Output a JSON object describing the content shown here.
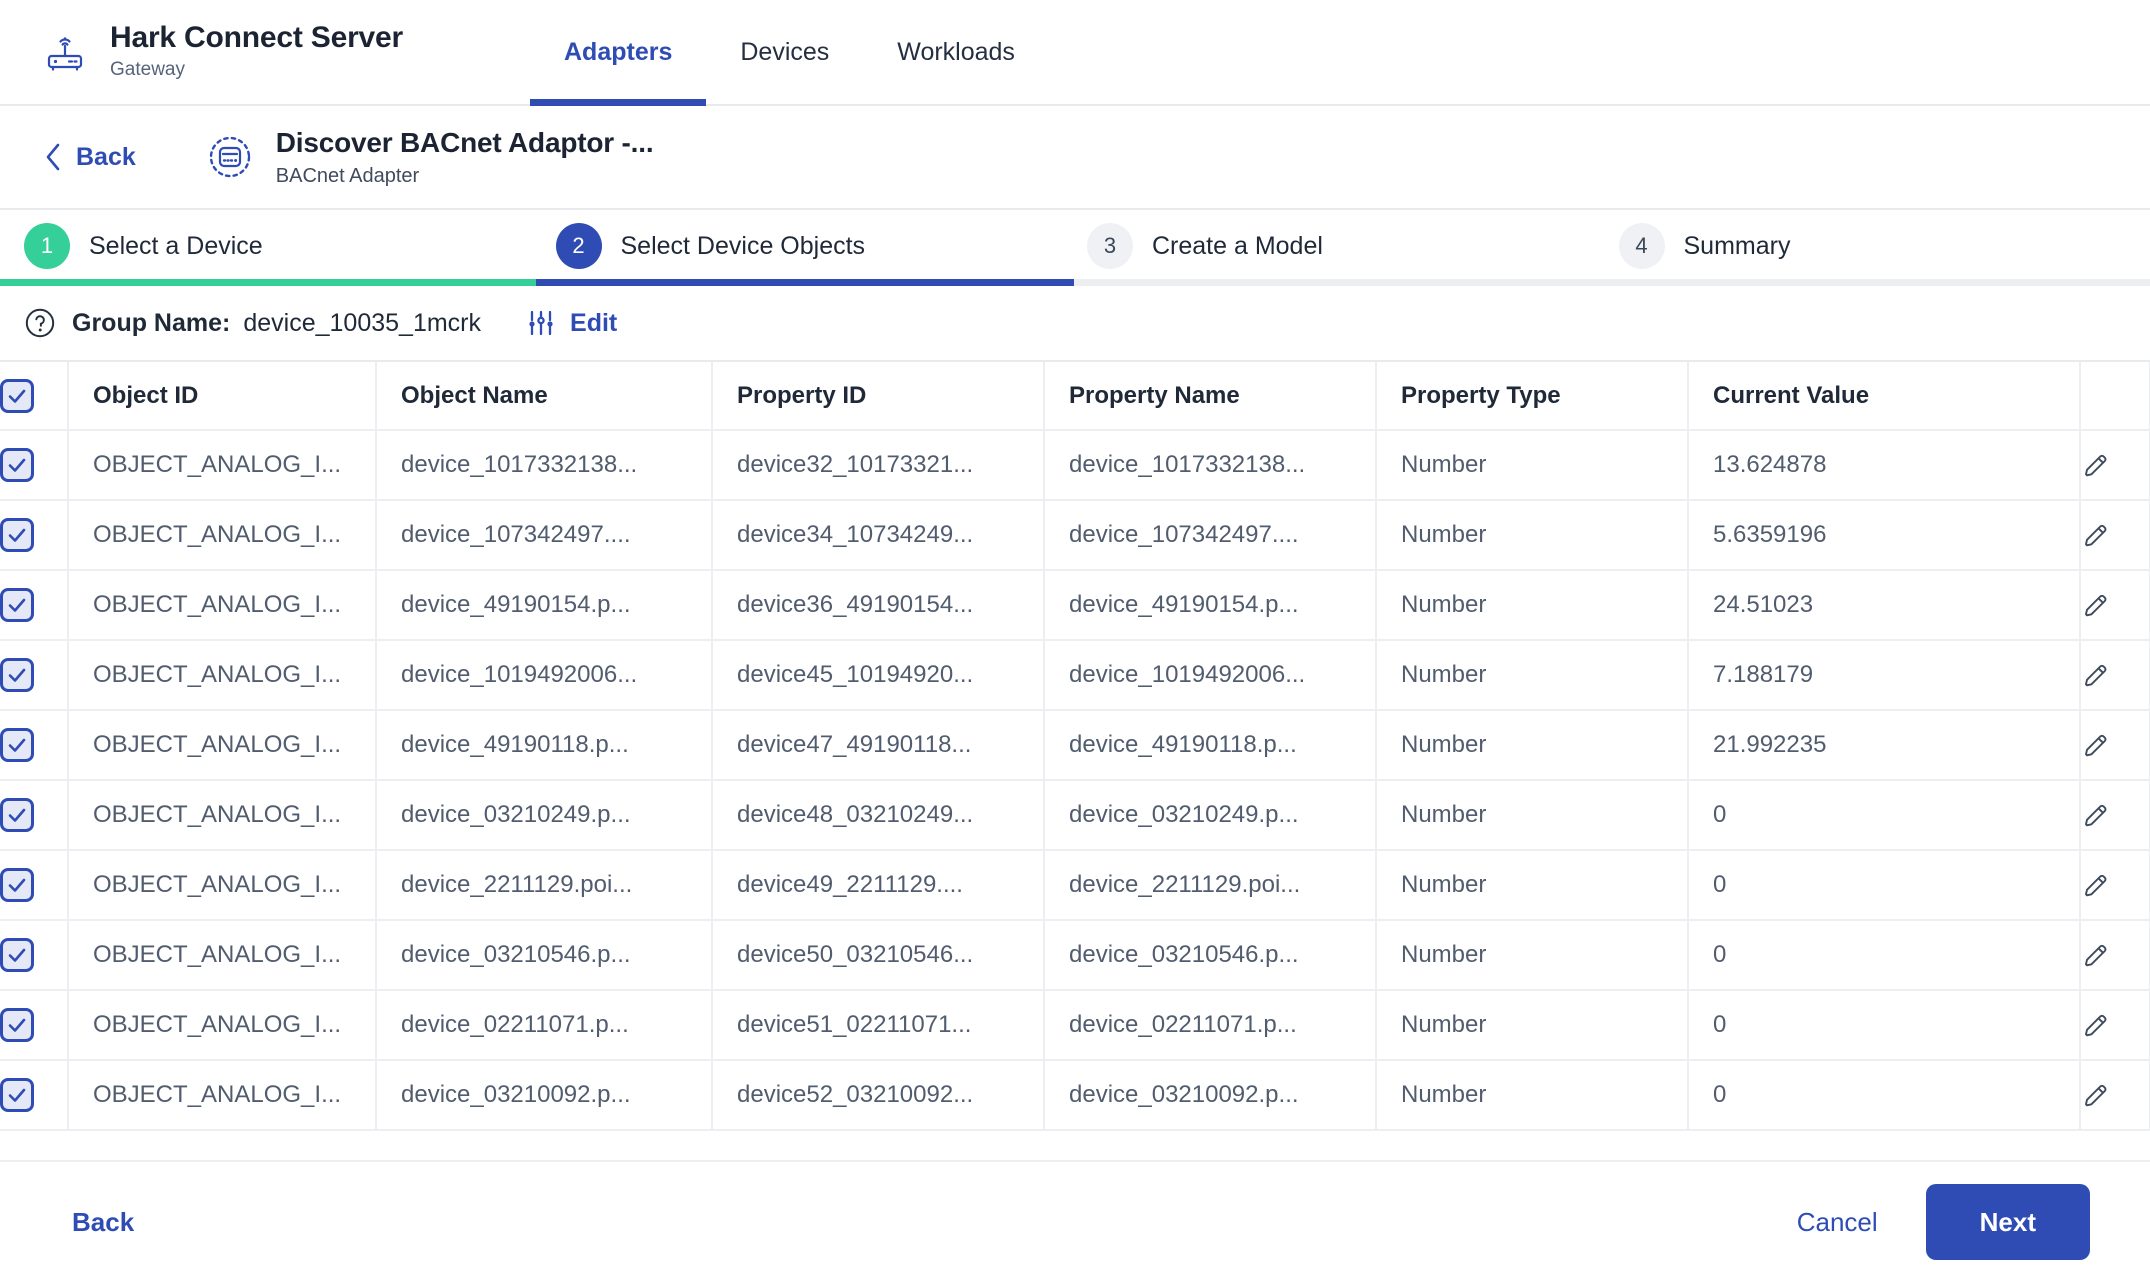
{
  "header": {
    "brand_icon": "router-gateway-icon",
    "title": "Hark Connect Server",
    "subtitle": "Gateway",
    "tabs": [
      {
        "label": "Adapters",
        "active": true
      },
      {
        "label": "Devices",
        "active": false
      },
      {
        "label": "Workloads",
        "active": false
      }
    ]
  },
  "subheader": {
    "back_label": "Back",
    "back_icon": "chevron-left-icon",
    "adapter_icon": "bacnet-adapter-icon",
    "adapter_title": "Discover BACnet Adaptor -...",
    "adapter_subtitle": "BACnet Adapter"
  },
  "stepper": {
    "steps": [
      {
        "number": "1",
        "label": "Select a Device",
        "state": "done"
      },
      {
        "number": "2",
        "label": "Select Device Objects",
        "state": "current"
      },
      {
        "number": "3",
        "label": "Create a Model",
        "state": "todo"
      },
      {
        "number": "4",
        "label": "Summary",
        "state": "todo"
      }
    ],
    "done_color": "#35cf99",
    "current_color": "#2f4cb5",
    "todo_color": "#f0f1f4"
  },
  "group_bar": {
    "help_icon": "question-circle-icon",
    "label": "Group Name:",
    "value": "device_10035_1mcrk",
    "edit_label": "Edit",
    "edit_icon": "tune-sliders-icon"
  },
  "table": {
    "select_all_checked": true,
    "columns": [
      "Object ID",
      "Object Name",
      "Property ID",
      "Property Name",
      "Property Type",
      "Current Value"
    ],
    "rows": [
      {
        "checked": true,
        "object_id": "OBJECT_ANALOG_I...",
        "object_name": "device_1017332138...",
        "property_id": "device32_10173321...",
        "property_name": "device_1017332138...",
        "property_type": "Number",
        "current_value": "13.624878",
        "edit_icon": "pencil-icon"
      },
      {
        "checked": true,
        "object_id": "OBJECT_ANALOG_I...",
        "object_name": "device_107342497....",
        "property_id": "device34_10734249...",
        "property_name": "device_107342497....",
        "property_type": "Number",
        "current_value": "5.6359196",
        "edit_icon": "pencil-icon"
      },
      {
        "checked": true,
        "object_id": "OBJECT_ANALOG_I...",
        "object_name": "device_49190154.p...",
        "property_id": "device36_49190154...",
        "property_name": "device_49190154.p...",
        "property_type": "Number",
        "current_value": "24.51023",
        "edit_icon": "pencil-icon"
      },
      {
        "checked": true,
        "object_id": "OBJECT_ANALOG_I...",
        "object_name": "device_1019492006...",
        "property_id": "device45_10194920...",
        "property_name": "device_1019492006...",
        "property_type": "Number",
        "current_value": "7.188179",
        "edit_icon": "pencil-icon"
      },
      {
        "checked": true,
        "object_id": "OBJECT_ANALOG_I...",
        "object_name": "device_49190118.p...",
        "property_id": "device47_49190118...",
        "property_name": "device_49190118.p...",
        "property_type": "Number",
        "current_value": "21.992235",
        "edit_icon": "pencil-icon"
      },
      {
        "checked": true,
        "object_id": "OBJECT_ANALOG_I...",
        "object_name": "device_03210249.p...",
        "property_id": "device48_03210249...",
        "property_name": "device_03210249.p...",
        "property_type": "Number",
        "current_value": "0",
        "edit_icon": "pencil-icon"
      },
      {
        "checked": true,
        "object_id": "OBJECT_ANALOG_I...",
        "object_name": "device_2211129.poi...",
        "property_id": "device49_2211129....",
        "property_name": "device_2211129.poi...",
        "property_type": "Number",
        "current_value": "0",
        "edit_icon": "pencil-icon"
      },
      {
        "checked": true,
        "object_id": "OBJECT_ANALOG_I...",
        "object_name": "device_03210546.p...",
        "property_id": "device50_03210546...",
        "property_name": "device_03210546.p...",
        "property_type": "Number",
        "current_value": "0",
        "edit_icon": "pencil-icon"
      },
      {
        "checked": true,
        "object_id": "OBJECT_ANALOG_I...",
        "object_name": "device_02211071.p...",
        "property_id": "device51_02211071...",
        "property_name": "device_02211071.p...",
        "property_type": "Number",
        "current_value": "0",
        "edit_icon": "pencil-icon"
      },
      {
        "checked": true,
        "object_id": "OBJECT_ANALOG_I...",
        "object_name": "device_03210092.p...",
        "property_id": "device52_03210092...",
        "property_name": "device_03210092.p...",
        "property_type": "Number",
        "current_value": "0",
        "edit_icon": "pencil-icon"
      }
    ]
  },
  "footer": {
    "back_label": "Back",
    "cancel_label": "Cancel",
    "next_label": "Next",
    "accent_color": "#2f4cb5"
  }
}
